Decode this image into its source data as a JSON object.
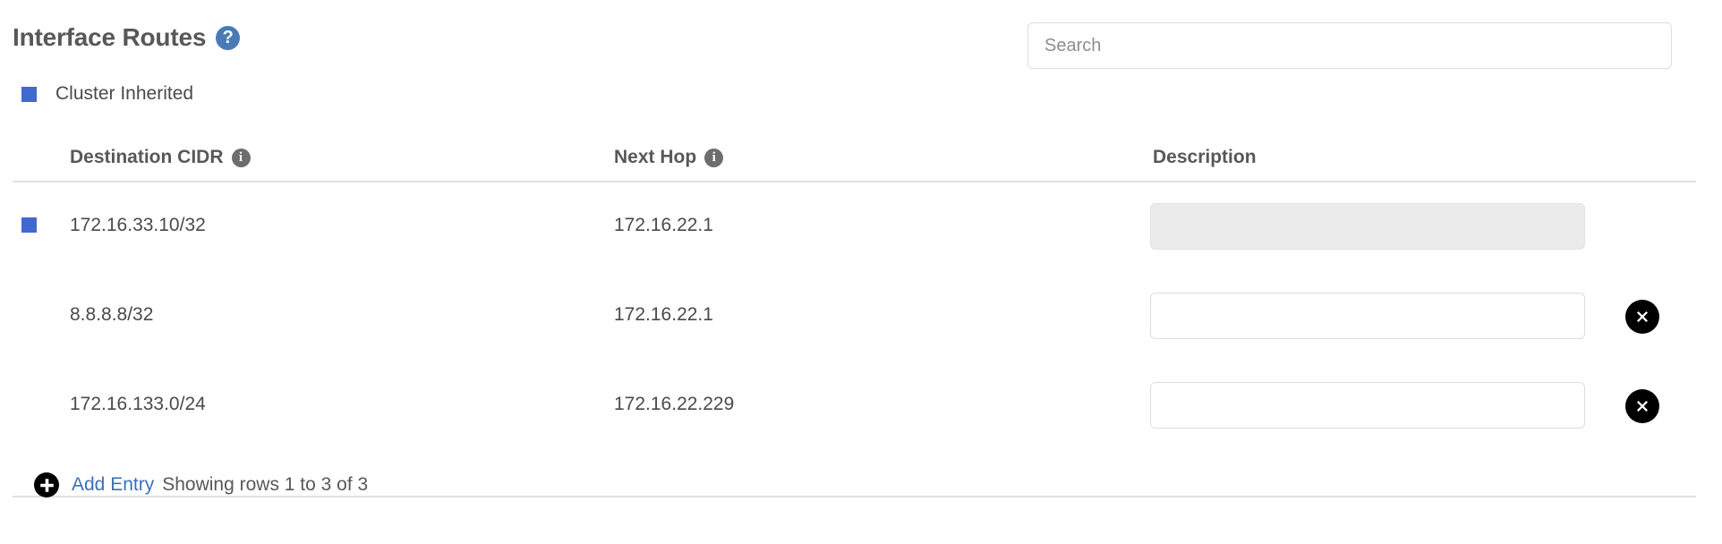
{
  "header": {
    "title": "Interface Routes",
    "help_icon": "help-circle-icon",
    "help_glyph": "?"
  },
  "legend": {
    "swatch_color": "#4268d0",
    "label": "Cluster Inherited"
  },
  "search": {
    "placeholder": "Search",
    "value": ""
  },
  "table": {
    "columns": [
      {
        "key": "destination_cidr",
        "label": "Destination CIDR",
        "has_info_icon": true,
        "info_glyph": "i"
      },
      {
        "key": "next_hop",
        "label": "Next Hop",
        "has_info_icon": true,
        "info_glyph": "i"
      },
      {
        "key": "description",
        "label": "Description",
        "has_info_icon": false,
        "info_glyph": ""
      }
    ],
    "rows": [
      {
        "cluster_inherited": true,
        "destination_cidr": "172.16.33.10/32",
        "next_hop": "172.16.22.1",
        "description": "",
        "description_placeholder": "",
        "description_disabled": true,
        "deletable": false
      },
      {
        "cluster_inherited": false,
        "destination_cidr": "8.8.8.8/32",
        "next_hop": "172.16.22.1",
        "description": "",
        "description_placeholder": "",
        "description_disabled": false,
        "deletable": true
      },
      {
        "cluster_inherited": false,
        "destination_cidr": "172.16.133.0/24",
        "next_hop": "172.16.22.229",
        "description": "",
        "description_placeholder": "",
        "description_disabled": false,
        "deletable": true
      }
    ]
  },
  "footer": {
    "add_icon": "plus-circle-icon",
    "add_label": "Add Entry",
    "rows_status": "Showing rows 1 to 3 of 3"
  },
  "colors": {
    "accent_blue": "#4268d0",
    "link_blue": "#3b71b8",
    "help_blue": "#4a7ab5",
    "info_gray": "#6d6d6d",
    "text": "#4a4a4a",
    "heading": "#585858",
    "border": "#dedede",
    "rule": "#e0e0e0",
    "disabled_bg": "#ebebeb"
  }
}
